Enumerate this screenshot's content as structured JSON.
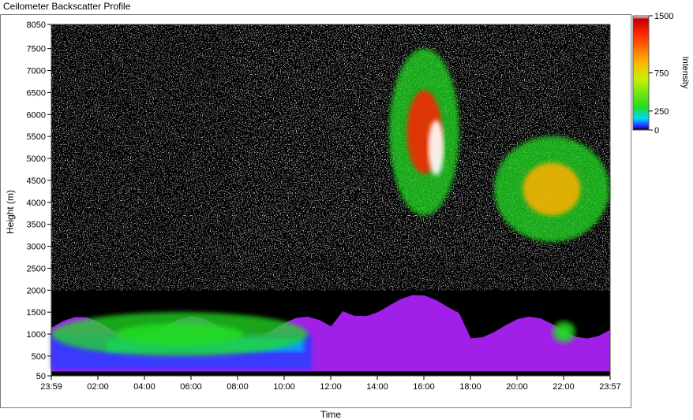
{
  "window": {
    "title": "Ceilometer Backscatter Profile"
  },
  "chart_data": {
    "type": "heatmap",
    "title": "Ceilometer Backscatter Profile",
    "xlabel": "Time",
    "ylabel": "Height (m)",
    "x_ticks": [
      "23:59",
      "02:00",
      "04:00",
      "06:00",
      "08:00",
      "10:00",
      "12:00",
      "14:00",
      "16:00",
      "18:00",
      "20:00",
      "22:00",
      "23:57"
    ],
    "y_ticks": [
      50,
      500,
      1000,
      1500,
      2000,
      2500,
      3000,
      3500,
      4000,
      4500,
      5000,
      5500,
      6000,
      6500,
      7000,
      7500,
      8050
    ],
    "ylim": [
      50,
      8050
    ],
    "colorbar": {
      "label": "Intensity",
      "ticks": [
        0,
        250,
        750,
        1500
      ],
      "range": [
        0,
        1500
      ]
    },
    "features": [
      {
        "description_time": "00:00-11:00",
        "height_range": [
          500,
          1500
        ],
        "intensity": 600
      },
      {
        "description_time": "14:30-17:30",
        "height_range": [
          3700,
          7500
        ],
        "intensity": 1500
      },
      {
        "description_time": "19:00-23:57",
        "height_range": [
          3100,
          5500
        ],
        "intensity": 900
      },
      {
        "description_time": "21:30-22:30",
        "height_range": [
          800,
          1300
        ],
        "intensity": 700
      }
    ],
    "colors": {
      "background": "#000000",
      "low": "#4b1a8f",
      "mid": "#22dd22",
      "high": "#ff2200",
      "peak": "#ffffff"
    }
  }
}
